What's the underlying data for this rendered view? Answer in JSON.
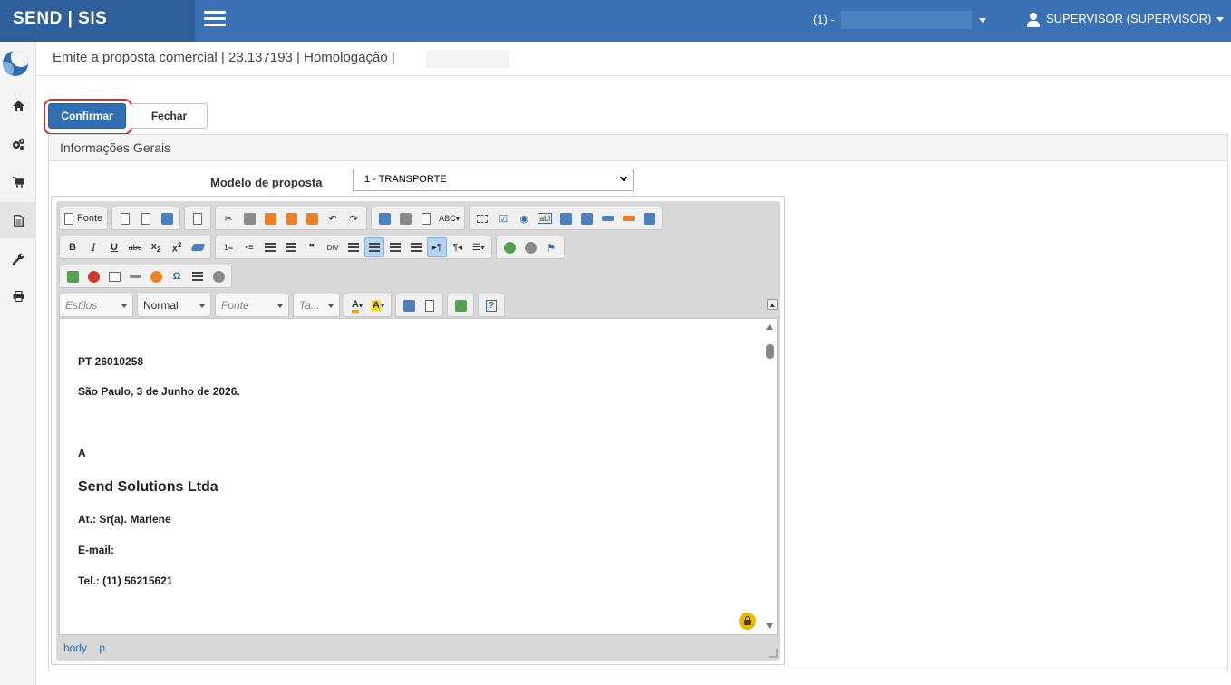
{
  "header": {
    "brand": "SEND | SIS",
    "company_prefix": "(1) -",
    "user": "SUPERVISOR (SUPERVISOR)"
  },
  "page": {
    "title": "Emite a proposta comercial | 23.137193 | Homologação |"
  },
  "actions": {
    "confirm_label": "Confirmar",
    "close_label": "Fechar"
  },
  "panel": {
    "title": "Informações Gerais",
    "model_label": "Modelo de proposta",
    "model_value": "1 - TRANSPORTE"
  },
  "editor": {
    "toolbar": {
      "source_label": "Fonte",
      "styles_placeholder": "Estilos",
      "format_value": "Normal",
      "font_placeholder": "Fonte",
      "size_placeholder": "Ta..."
    },
    "content": {
      "ref": "PT 26010258",
      "date_line": "São Paulo, 3 de Junho de 2026.",
      "to": "A",
      "company": "Send Solutions Ltda",
      "attn": "At.: Sr(a). Marlene",
      "email": "E-mail:",
      "phone": "Tel.:  (11) 56215621"
    },
    "path": [
      "body",
      "p"
    ]
  },
  "colors": {
    "topbar": "#3a72b5",
    "brand_bg": "#2e5f9a",
    "primary_button": "#2f6fb2",
    "highlight_ring": "#e02a2a"
  }
}
